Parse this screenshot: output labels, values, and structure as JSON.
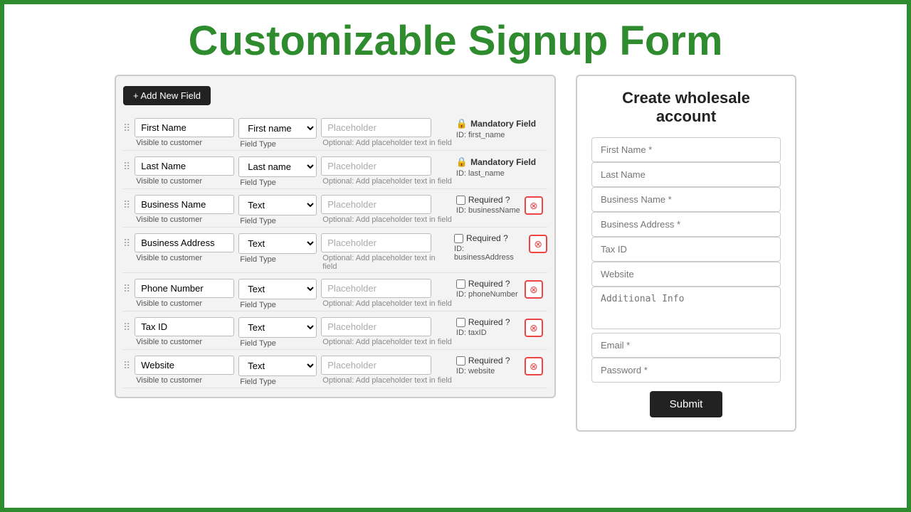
{
  "page": {
    "title": "Customizable Signup Form"
  },
  "left_panel": {
    "add_btn": "+ Add New Field",
    "fields": [
      {
        "name": "First Name",
        "type": "First name",
        "placeholder": "Placeholder",
        "visible": "Visible to customer",
        "field_type_label": "Field Type",
        "optional_note": "Optional: Add placeholder text in field",
        "mandatory": true,
        "mandatory_label": "Mandatory Field",
        "id_label": "ID: first_name"
      },
      {
        "name": "Last Name",
        "type": "Last name",
        "placeholder": "Placeholder",
        "visible": "Visible to customer",
        "field_type_label": "Field Type",
        "optional_note": "Optional: Add placeholder text in field",
        "mandatory": true,
        "mandatory_label": "Mandatory Field",
        "id_label": "ID: last_name"
      },
      {
        "name": "Business Name",
        "type": "Text",
        "placeholder": "Placeholder",
        "visible": "Visible to customer",
        "field_type_label": "Field Type",
        "optional_note": "Optional: Add placeholder text in field",
        "mandatory": false,
        "required_label": "Required ?",
        "id_label": "ID: businessName"
      },
      {
        "name": "Business Address",
        "type": "Text",
        "placeholder": "Placeholder",
        "visible": "Visible to customer",
        "field_type_label": "Field Type",
        "optional_note": "Optional: Add placeholder text in field",
        "mandatory": false,
        "required_label": "Required ?",
        "id_label": "ID: businessAddress"
      },
      {
        "name": "Phone Number",
        "type": "Text",
        "placeholder": "Placeholder",
        "visible": "Visible to customer",
        "field_type_label": "Field Type",
        "optional_note": "Optional: Add placeholder text in field",
        "mandatory": false,
        "required_label": "Required ?",
        "id_label": "ID: phoneNumber"
      },
      {
        "name": "Tax ID",
        "type": "Text",
        "placeholder": "Placeholder",
        "visible": "Visible to customer",
        "field_type_label": "Field Type",
        "optional_note": "Optional: Add placeholder text in field",
        "mandatory": false,
        "required_label": "Required ?",
        "id_label": "ID: taxID"
      },
      {
        "name": "Website",
        "type": "Text",
        "placeholder": "Placeholder",
        "visible": "Visible to customer",
        "field_type_label": "Field Type",
        "optional_note": "Optional: Add placeholder text in field",
        "mandatory": false,
        "required_label": "Required ?",
        "id_label": "ID: website"
      }
    ]
  },
  "right_panel": {
    "title": "Create wholesale account",
    "fields": [
      {
        "label": "First Name *",
        "type": "input"
      },
      {
        "label": "Last Name",
        "type": "input"
      },
      {
        "label": "Business Name *",
        "type": "input"
      },
      {
        "label": "Business Address *",
        "type": "input"
      },
      {
        "label": "Tax ID",
        "type": "input"
      },
      {
        "label": "Website",
        "type": "input"
      },
      {
        "label": "Additional Info",
        "type": "textarea"
      },
      {
        "label": "Email *",
        "type": "input"
      },
      {
        "label": "Password *",
        "type": "input"
      }
    ],
    "submit_label": "Submit"
  }
}
